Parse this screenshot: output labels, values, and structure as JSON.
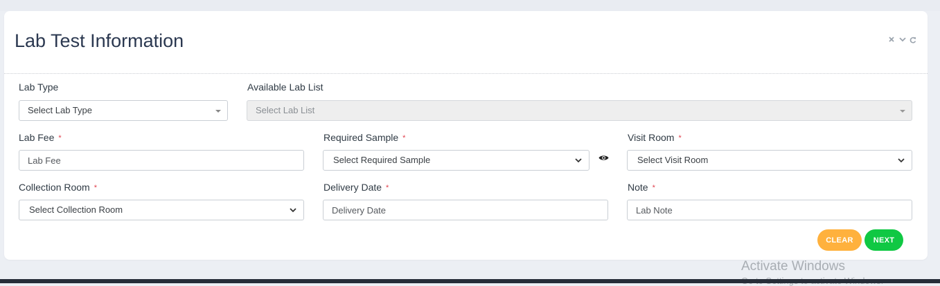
{
  "card": {
    "title": "Lab Test Information",
    "tools": [
      "close-icon",
      "chevron-down-icon",
      "refresh-icon"
    ]
  },
  "form": {
    "lab_type": {
      "label": "Lab Type",
      "value": "Select Lab Type"
    },
    "available_lab_list": {
      "label": "Available Lab List",
      "value": "Select Lab List",
      "disabled": true
    },
    "lab_fee": {
      "label": "Lab Fee",
      "placeholder": "Lab Fee",
      "required": true
    },
    "required_sample": {
      "label": "Required Sample",
      "value": "Select Required Sample",
      "required": true
    },
    "visit_room": {
      "label": "Visit Room",
      "value": "Select Visit Room",
      "required": true
    },
    "collection_room": {
      "label": "Collection Room",
      "value": "Select Collection Room",
      "required": true
    },
    "delivery_date": {
      "label": "Delivery Date",
      "placeholder": "Delivery Date",
      "required": true
    },
    "note": {
      "label": "Note",
      "placeholder": "Lab Note",
      "required": true
    },
    "required_marker": "*"
  },
  "buttons": {
    "clear": "CLEAR",
    "next": "NEXT"
  },
  "colors": {
    "clear": "#ffb13d",
    "next": "#10c843",
    "title": "#2b3850",
    "required": "#e0404c"
  },
  "watermark": {
    "line1": "Activate Windows",
    "line2": "Go to Settings to activate Windows."
  }
}
